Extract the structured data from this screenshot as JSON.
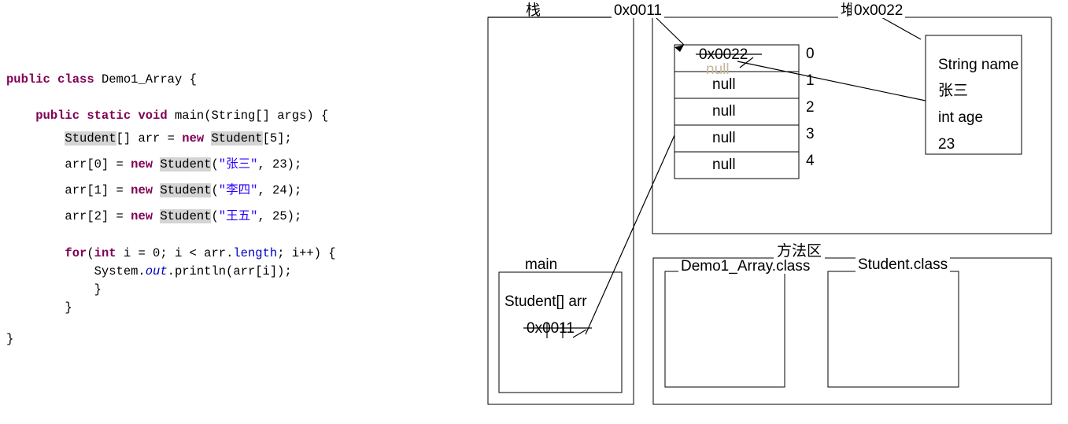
{
  "code": {
    "language": "java",
    "lines": [
      {
        "id": "l1",
        "text": "public class Demo1_Array {"
      },
      {
        "id": "l2",
        "text": ""
      },
      {
        "id": "l3",
        "text": "    public static void main(String[] args) {"
      },
      {
        "id": "l4",
        "text": "        Student[] arr = new Student[5];"
      },
      {
        "id": "l5",
        "text": "        arr[0] = new Student(\"张三\", 23);"
      },
      {
        "id": "l6",
        "text": "        arr[1] = new Student(\"李四\", 24);"
      },
      {
        "id": "l7",
        "text": "        arr[2] = new Student(\"王五\", 25);"
      },
      {
        "id": "l8",
        "text": ""
      },
      {
        "id": "l9",
        "text": "        for(int i = 0; i < arr.length; i++) {"
      },
      {
        "id": "l10",
        "text": "            System.out.println(arr[i]);"
      },
      {
        "id": "l11",
        "text": "        }"
      },
      {
        "id": "l12",
        "text": "    }"
      },
      {
        "id": "l13",
        "text": ""
      },
      {
        "id": "l14",
        "text": "}"
      }
    ],
    "class_name": "Demo1_Array",
    "method_name": "main",
    "array_type": "Student",
    "array_var": "arr",
    "array_size": "5",
    "names": [
      "张三",
      "李四",
      "王五"
    ],
    "ages": [
      "23",
      "24",
      "25"
    ],
    "colors": {
      "keyword": "#7f0055",
      "string": "#2a00ff",
      "field": "#0000c0",
      "highlight": "#d4d4d4",
      "text": "#000000"
    }
  },
  "diagram": {
    "stack": {
      "region_label": "栈",
      "pointer_address": "0x0011",
      "frame": {
        "title": "main",
        "var_declaration": "Student[] arr",
        "var_value": "0x0011"
      }
    },
    "heap": {
      "region_label": "堆",
      "object_address": "0x0022",
      "array": {
        "cells": [
          {
            "index": "0",
            "value": "0x0022",
            "ghost": "null"
          },
          {
            "index": "1",
            "value": "null",
            "ghost": ""
          },
          {
            "index": "2",
            "value": "null",
            "ghost": ""
          },
          {
            "index": "3",
            "value": "null",
            "ghost": ""
          },
          {
            "index": "4",
            "value": "null",
            "ghost": ""
          }
        ]
      },
      "object": {
        "fields": [
          {
            "type": "String name",
            "value": "张三"
          },
          {
            "type": "int age",
            "value": "23"
          }
        ]
      }
    },
    "method_area": {
      "region_label": "方法区",
      "classes": [
        {
          "name": "Demo1_Array.class"
        },
        {
          "name": "Student.class"
        }
      ]
    },
    "colors": {
      "stroke": "#000000",
      "background": "#ffffff"
    }
  }
}
